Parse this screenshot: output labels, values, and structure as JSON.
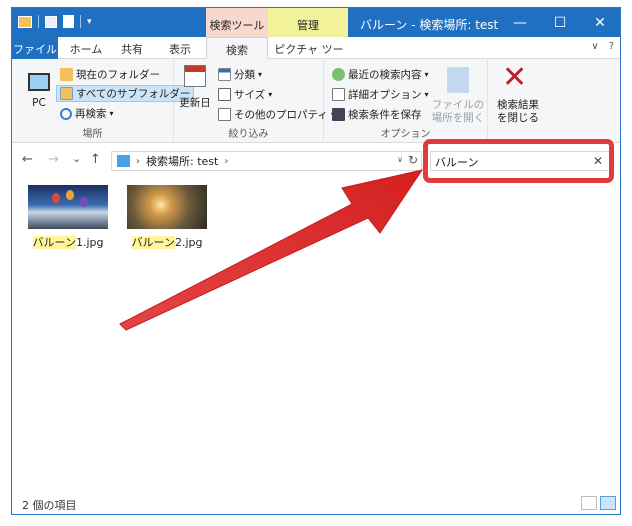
{
  "qat": {
    "dropdown": "▾"
  },
  "context_tabs": {
    "search_tools": "検索ツール",
    "manage": "管理"
  },
  "window": {
    "title": "バルーン - 検索場所: test",
    "minimize": "—",
    "maximize": "☐",
    "close": "✕"
  },
  "ribbon_tabs": {
    "file": "ファイル",
    "home": "ホーム",
    "share": "共有",
    "view": "表示",
    "search": "検索",
    "picture": "ピクチャ ツール",
    "collapse": "∨",
    "help": "?"
  },
  "ribbon": {
    "location": {
      "pc": "PC",
      "current_folder": "現在のフォルダー",
      "all_subfolders": "すべてのサブフォルダー",
      "search_again": "再検索",
      "label": "場所"
    },
    "refine": {
      "date_modified": "更新日",
      "kind": "分類",
      "size": "サイズ",
      "other_properties": "その他のプロパティ",
      "label": "絞り込み"
    },
    "options": {
      "recent_searches": "最近の検索内容",
      "advanced_options": "詳細オプション",
      "save_search": "検索条件を保存",
      "open_location_line1": "ファイルの",
      "open_location_line2": "場所を開く",
      "label": "オプション"
    },
    "close_search": {
      "line1": "検索結果",
      "line2": "を閉じる"
    }
  },
  "nav": {
    "back": "←",
    "forward": "→",
    "recent": "⌄",
    "up": "↑",
    "address_path": "検索場所: test",
    "refresh": "↻"
  },
  "search": {
    "value": "バルーン",
    "clear": "✕"
  },
  "files": [
    {
      "highlight": "バルーン",
      "rest": "1.jpg"
    },
    {
      "highlight": "バルーン",
      "rest": "2.jpg"
    }
  ],
  "status": {
    "item_count": "2 個の項目"
  },
  "colors": {
    "titlebar": "#1f70c1",
    "search_tools_tab": "#f7d8cf",
    "manage_tab": "#f2f29a",
    "annotation_red": "#e23b3b",
    "match_highlight": "#fff59a"
  }
}
